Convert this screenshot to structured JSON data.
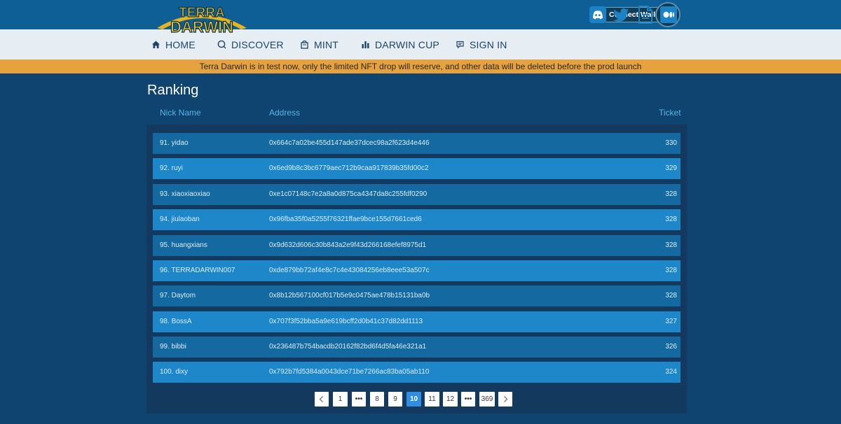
{
  "brand": {
    "line1": "TERRA",
    "line2": "DARWIN"
  },
  "wallet": {
    "label": "Connect Wallet"
  },
  "nav": [
    {
      "label": "HOME",
      "icon": "home-icon"
    },
    {
      "label": "DISCOVER",
      "icon": "search-icon"
    },
    {
      "label": "MINT",
      "icon": "bag-icon"
    },
    {
      "label": "DARWIN CUP",
      "icon": "bar-chart-icon"
    },
    {
      "label": "SIGN IN",
      "icon": "chat-icon"
    }
  ],
  "social": [
    "discord-icon",
    "twitter-icon",
    "document-icon",
    "medium-icon"
  ],
  "notice": "Terra Darwin is in test now, only the limited NFT drop will reserve, and other data will be deleted before the prod launch",
  "ranking": {
    "title": "Ranking",
    "headers": {
      "nick": "Nick Name",
      "address": "Address",
      "ticket": "Ticket"
    },
    "rows": [
      {
        "nick": "91. yidao",
        "address": "0x664c7a02be455d147ade37dcec98a2f623d4e446",
        "ticket": "330"
      },
      {
        "nick": "92. ruyi",
        "address": "0x6ed9b8c3bc6779aec712b9caa917839b35fd00c2",
        "ticket": "329"
      },
      {
        "nick": "93. xiaoxiaoxiao",
        "address": "0xe1c07148c7e2a8a0d875ca4347da8c255fdf0290",
        "ticket": "328"
      },
      {
        "nick": "94. jiulaoban",
        "address": "0x96fba35f0a5255f76321ffae9bce155d7661ced6",
        "ticket": "328"
      },
      {
        "nick": "95. huangxians",
        "address": "0x9d632d606c30b843a2e9f43d266168efef8975d1",
        "ticket": "328"
      },
      {
        "nick": "96. TERRADARWIN007",
        "address": "0xde879bb72af4e8c7c4e43084256eb8eee53a507c",
        "ticket": "328"
      },
      {
        "nick": "97. Daytom",
        "address": "0x8b12b567100cf017b5e9c0475ae478b15131ba0b",
        "ticket": "328"
      },
      {
        "nick": "98. BossA",
        "address": "0x707f3f52bba5a9e619bcff2d0b41c37d82dd1113",
        "ticket": "327"
      },
      {
        "nick": "99. bibbi",
        "address": "0x236487b754bacdb20162f82bd6f4d5fa46e321a1",
        "ticket": "326"
      },
      {
        "nick": "100. dixy",
        "address": "0x792b7fd5384a0043dce71be7266ac83ba05ab110",
        "ticket": "324"
      }
    ]
  },
  "pagination": {
    "prev_icon": "chevron-left-icon",
    "next_icon": "chevron-right-icon",
    "items": [
      "1",
      "•••",
      "8",
      "9",
      "10",
      "11",
      "12",
      "•••",
      "369"
    ],
    "current": "10"
  },
  "colors": {
    "accent": "#e6a23f",
    "brand_blue": "#0d5f96",
    "page_bg": "#0f4470"
  }
}
